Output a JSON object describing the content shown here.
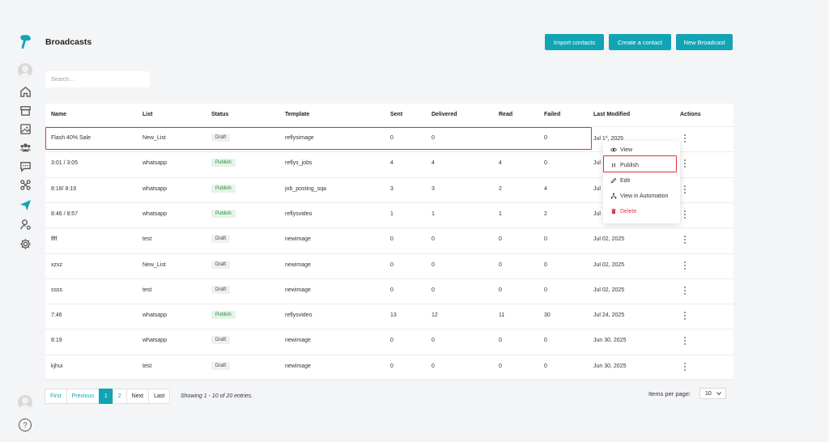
{
  "header": {
    "title": "Broadcasts",
    "buttons": [
      "Import contacts",
      "Create a contact",
      "New Broadcast"
    ]
  },
  "search": {
    "placeholder": "Search..."
  },
  "table": {
    "columns": [
      "Name",
      "List",
      "Status",
      "Template",
      "Sent",
      "Delivered",
      "Read",
      "Failed",
      "Last Modified",
      "Actions"
    ],
    "rows": [
      {
        "name": "Flash 40% Sale",
        "list": "New_List",
        "status": "Draft",
        "template": "reflysimage",
        "sent": "0",
        "delivered": "0",
        "read": "",
        "failed": "0",
        "modified": "Jul 1⁰, 2025"
      },
      {
        "name": "3:01 / 3:05",
        "list": "whatsapp",
        "status": "Publish",
        "template": "reflys_jobs",
        "sent": "4",
        "delivered": "4",
        "read": "4",
        "failed": "0",
        "modified": "Jul"
      },
      {
        "name": "8:18/ 8:19",
        "list": "whatsapp",
        "status": "Publish",
        "template": "job_posting_sqa",
        "sent": "3",
        "delivered": "3",
        "read": "2",
        "failed": "4",
        "modified": "Jul"
      },
      {
        "name": "8:46 / 8:57",
        "list": "whatsapp",
        "status": "Publish",
        "template": "reflysvideo",
        "sent": "1",
        "delivered": "1",
        "read": "1",
        "failed": "2",
        "modified": "Jul"
      },
      {
        "name": "ffff",
        "list": "test",
        "status": "Draft",
        "template": "newimage",
        "sent": "0",
        "delivered": "0",
        "read": "0",
        "failed": "0",
        "modified": "Jul 02, 2025"
      },
      {
        "name": "xzxz",
        "list": "New_List",
        "status": "Draft",
        "template": "newimage",
        "sent": "0",
        "delivered": "0",
        "read": "0",
        "failed": "0",
        "modified": "Jul 02, 2025"
      },
      {
        "name": "ssss",
        "list": "test",
        "status": "Draft",
        "template": "newimage",
        "sent": "0",
        "delivered": "0",
        "read": "0",
        "failed": "0",
        "modified": "Jul 02, 2025"
      },
      {
        "name": "7:46",
        "list": "whatsapp",
        "status": "Publish",
        "template": "reflysvideo",
        "sent": "13",
        "delivered": "12",
        "read": "11",
        "failed": "30",
        "modified": "Jul 24, 2025"
      },
      {
        "name": "8:19",
        "list": "whatsapp",
        "status": "Draft",
        "template": "newimage",
        "sent": "0",
        "delivered": "0",
        "read": "0",
        "failed": "0",
        "modified": "Jun 30, 2025"
      },
      {
        "name": "kjhui",
        "list": "test",
        "status": "Draft",
        "template": "newimage",
        "sent": "0",
        "delivered": "0",
        "read": "0",
        "failed": "0",
        "modified": "Jun 30, 2025"
      }
    ]
  },
  "row_menu": {
    "items": [
      {
        "label": "View",
        "icon": "eye-icon"
      },
      {
        "label": "Publish",
        "icon": "pause-icon"
      },
      {
        "label": "Edit",
        "icon": "pencil-icon"
      },
      {
        "label": "View in Automation",
        "icon": "flow-icon"
      },
      {
        "label": "Delete",
        "icon": "trash-icon"
      }
    ]
  },
  "pagination": {
    "first": "First",
    "previous": "Previous",
    "pages": [
      "1",
      "2"
    ],
    "current": "1",
    "next": "Next",
    "last": "Last",
    "showing": "Showing 1 - 10 of 20 entries.",
    "items_per_page_label": "Items per page:",
    "items_per_page": "10"
  },
  "sidebar": {
    "icons": [
      "logo",
      "avatar",
      "home-icon",
      "store-icon",
      "image-icon",
      "users-icon",
      "chat-icon",
      "integrations-icon",
      "send-icon",
      "user-settings-icon",
      "gear-icon"
    ]
  },
  "help": {
    "label": "?"
  },
  "colors": {
    "accent": "#12a4b5",
    "highlight": "#e03131",
    "publish_bg": "#e3f5e6",
    "publish_text": "#1e8c3a",
    "danger": "#d9363e"
  }
}
